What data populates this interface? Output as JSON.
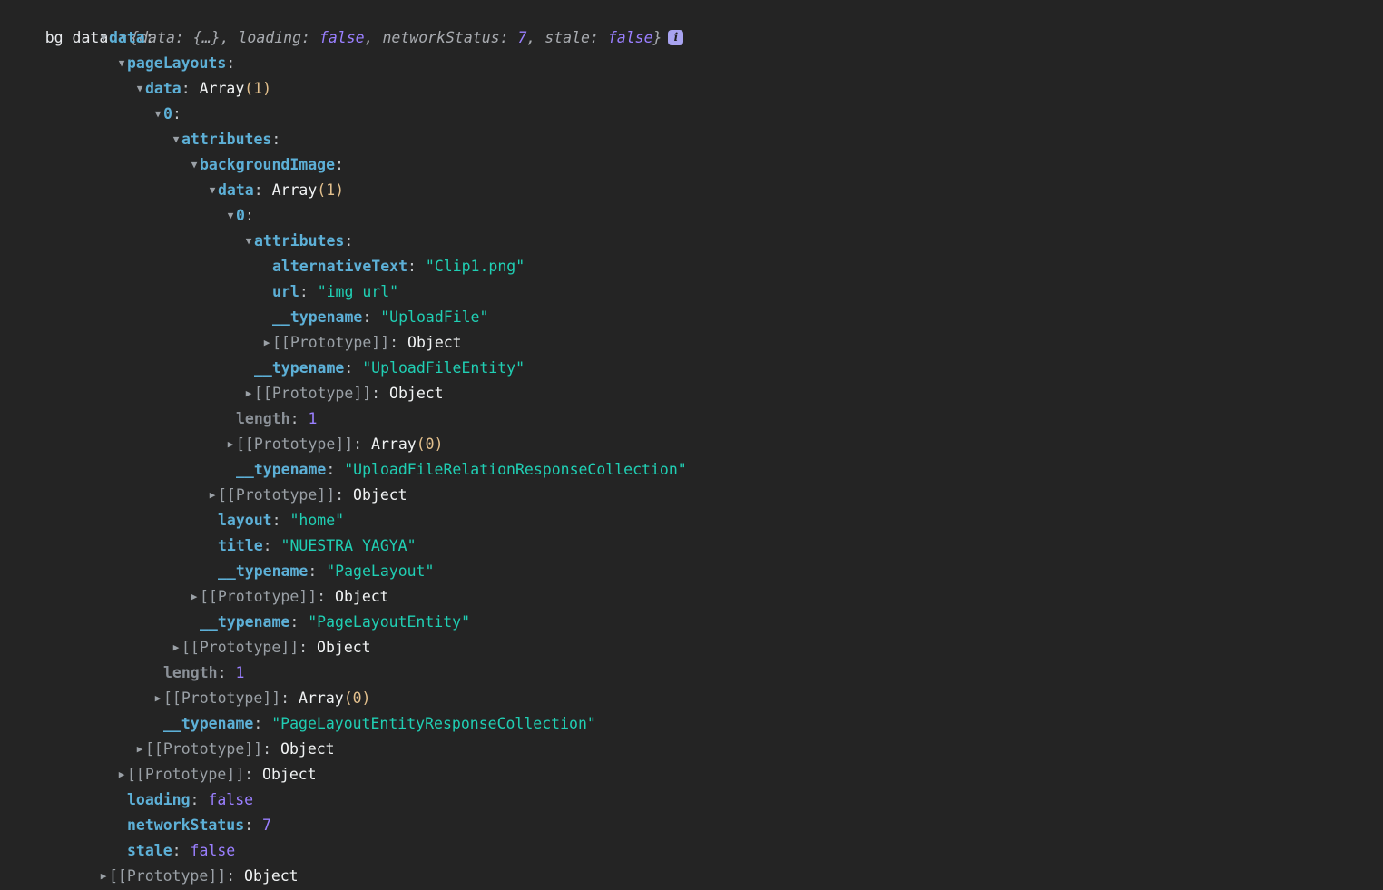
{
  "console": {
    "background_color": "#242424",
    "accent_colors": {
      "property_key": "#5db0d7",
      "string_value": "#20cfb4",
      "number_value": "#9a7fff",
      "boolean_value": "#9a7fff",
      "prototype_label": "#9aa0a6",
      "object_word": "#f1f3f4",
      "array_count": "#e3c08d",
      "info_badge_bg": "#a8a3f0"
    },
    "header": {
      "label": "bg data",
      "triangle": "triangle-down-icon",
      "preview": {
        "open_brace": "{",
        "close_brace": "}",
        "parts": [
          {
            "key": "data",
            "sep": ": ",
            "value": "{…}",
            "kind": "object",
            "trail": ", "
          },
          {
            "key": "loading",
            "sep": ": ",
            "value": "false",
            "kind": "bool",
            "trail": ", "
          },
          {
            "key": "networkStatus",
            "sep": ": ",
            "value": "7",
            "kind": "num",
            "trail": ", "
          },
          {
            "key": "stale",
            "sep": ": ",
            "value": "false",
            "kind": "bool",
            "trail": ""
          }
        ]
      },
      "info_badge": "i"
    },
    "rows": [
      {
        "indent": 1,
        "tri": "open",
        "key": "data",
        "keytype": "key",
        "value": "",
        "valtype": "none"
      },
      {
        "indent": 2,
        "tri": "open",
        "key": "pageLayouts",
        "keytype": "key",
        "value": "",
        "valtype": "none"
      },
      {
        "indent": 3,
        "tri": "open",
        "key": "data",
        "keytype": "key",
        "value": "Array(1)",
        "valtype": "array"
      },
      {
        "indent": 4,
        "tri": "open",
        "key": "0",
        "keytype": "key",
        "value": "",
        "valtype": "none"
      },
      {
        "indent": 5,
        "tri": "open",
        "key": "attributes",
        "keytype": "key",
        "value": "",
        "valtype": "none"
      },
      {
        "indent": 6,
        "tri": "open",
        "key": "backgroundImage",
        "keytype": "key",
        "value": "",
        "valtype": "none"
      },
      {
        "indent": 7,
        "tri": "open",
        "key": "data",
        "keytype": "key",
        "value": "Array(1)",
        "valtype": "array"
      },
      {
        "indent": 8,
        "tri": "open",
        "key": "0",
        "keytype": "key",
        "value": "",
        "valtype": "none"
      },
      {
        "indent": 9,
        "tri": "open",
        "key": "attributes",
        "keytype": "key",
        "value": "",
        "valtype": "none"
      },
      {
        "indent": 10,
        "tri": "spacer",
        "key": "alternativeText",
        "keytype": "key",
        "value": "\"Clip1.png\"",
        "valtype": "string"
      },
      {
        "indent": 10,
        "tri": "spacer",
        "key": "url",
        "keytype": "key",
        "value": "\"img url\"",
        "valtype": "string"
      },
      {
        "indent": 10,
        "tri": "spacer",
        "key": "__typename",
        "keytype": "key",
        "value": "\"UploadFile\"",
        "valtype": "string"
      },
      {
        "indent": 10,
        "tri": "closed",
        "key": "[[Prototype]]",
        "keytype": "key-proto",
        "value": "Object",
        "valtype": "object"
      },
      {
        "indent": 9,
        "tri": "spacer",
        "key": "__typename",
        "keytype": "key",
        "value": "\"UploadFileEntity\"",
        "valtype": "string"
      },
      {
        "indent": 9,
        "tri": "closed",
        "key": "[[Prototype]]",
        "keytype": "key-proto",
        "value": "Object",
        "valtype": "object"
      },
      {
        "indent": 8,
        "tri": "spacer",
        "key": "length",
        "keytype": "key-dim",
        "value": "1",
        "valtype": "number"
      },
      {
        "indent": 8,
        "tri": "closed",
        "key": "[[Prototype]]",
        "keytype": "key-proto",
        "value": "Array(0)",
        "valtype": "array"
      },
      {
        "indent": 8,
        "tri": "spacer",
        "key": "__typename",
        "keytype": "key",
        "value": "\"UploadFileRelationResponseCollection\"",
        "valtype": "string"
      },
      {
        "indent": 7,
        "tri": "closed",
        "key": "[[Prototype]]",
        "keytype": "key-proto",
        "value": "Object",
        "valtype": "object"
      },
      {
        "indent": 7,
        "tri": "spacer",
        "key": "layout",
        "keytype": "key",
        "value": "\"home\"",
        "valtype": "string"
      },
      {
        "indent": 7,
        "tri": "spacer",
        "key": "title",
        "keytype": "key",
        "value": "\"NUESTRA YAGYA\"",
        "valtype": "string"
      },
      {
        "indent": 7,
        "tri": "spacer",
        "key": "__typename",
        "keytype": "key",
        "value": "\"PageLayout\"",
        "valtype": "string"
      },
      {
        "indent": 6,
        "tri": "closed",
        "key": "[[Prototype]]",
        "keytype": "key-proto",
        "value": "Object",
        "valtype": "object"
      },
      {
        "indent": 6,
        "tri": "spacer",
        "key": "__typename",
        "keytype": "key",
        "value": "\"PageLayoutEntity\"",
        "valtype": "string"
      },
      {
        "indent": 5,
        "tri": "closed",
        "key": "[[Prototype]]",
        "keytype": "key-proto",
        "value": "Object",
        "valtype": "object"
      },
      {
        "indent": 4,
        "tri": "spacer",
        "key": "length",
        "keytype": "key-dim",
        "value": "1",
        "valtype": "number"
      },
      {
        "indent": 4,
        "tri": "closed",
        "key": "[[Prototype]]",
        "keytype": "key-proto",
        "value": "Array(0)",
        "valtype": "array"
      },
      {
        "indent": 4,
        "tri": "spacer",
        "key": "__typename",
        "keytype": "key",
        "value": "\"PageLayoutEntityResponseCollection\"",
        "valtype": "string"
      },
      {
        "indent": 3,
        "tri": "closed",
        "key": "[[Prototype]]",
        "keytype": "key-proto",
        "value": "Object",
        "valtype": "object"
      },
      {
        "indent": 2,
        "tri": "closed",
        "key": "[[Prototype]]",
        "keytype": "key-proto",
        "value": "Object",
        "valtype": "object"
      },
      {
        "indent": 2,
        "tri": "spacer",
        "key": "loading",
        "keytype": "key",
        "value": "false",
        "valtype": "bool"
      },
      {
        "indent": 2,
        "tri": "spacer",
        "key": "networkStatus",
        "keytype": "key",
        "value": "7",
        "valtype": "number"
      },
      {
        "indent": 2,
        "tri": "spacer",
        "key": "stale",
        "keytype": "key",
        "value": "false",
        "valtype": "bool"
      },
      {
        "indent": 1,
        "tri": "closed",
        "key": "[[Prototype]]",
        "keytype": "key-proto",
        "value": "Object",
        "valtype": "object"
      }
    ]
  }
}
